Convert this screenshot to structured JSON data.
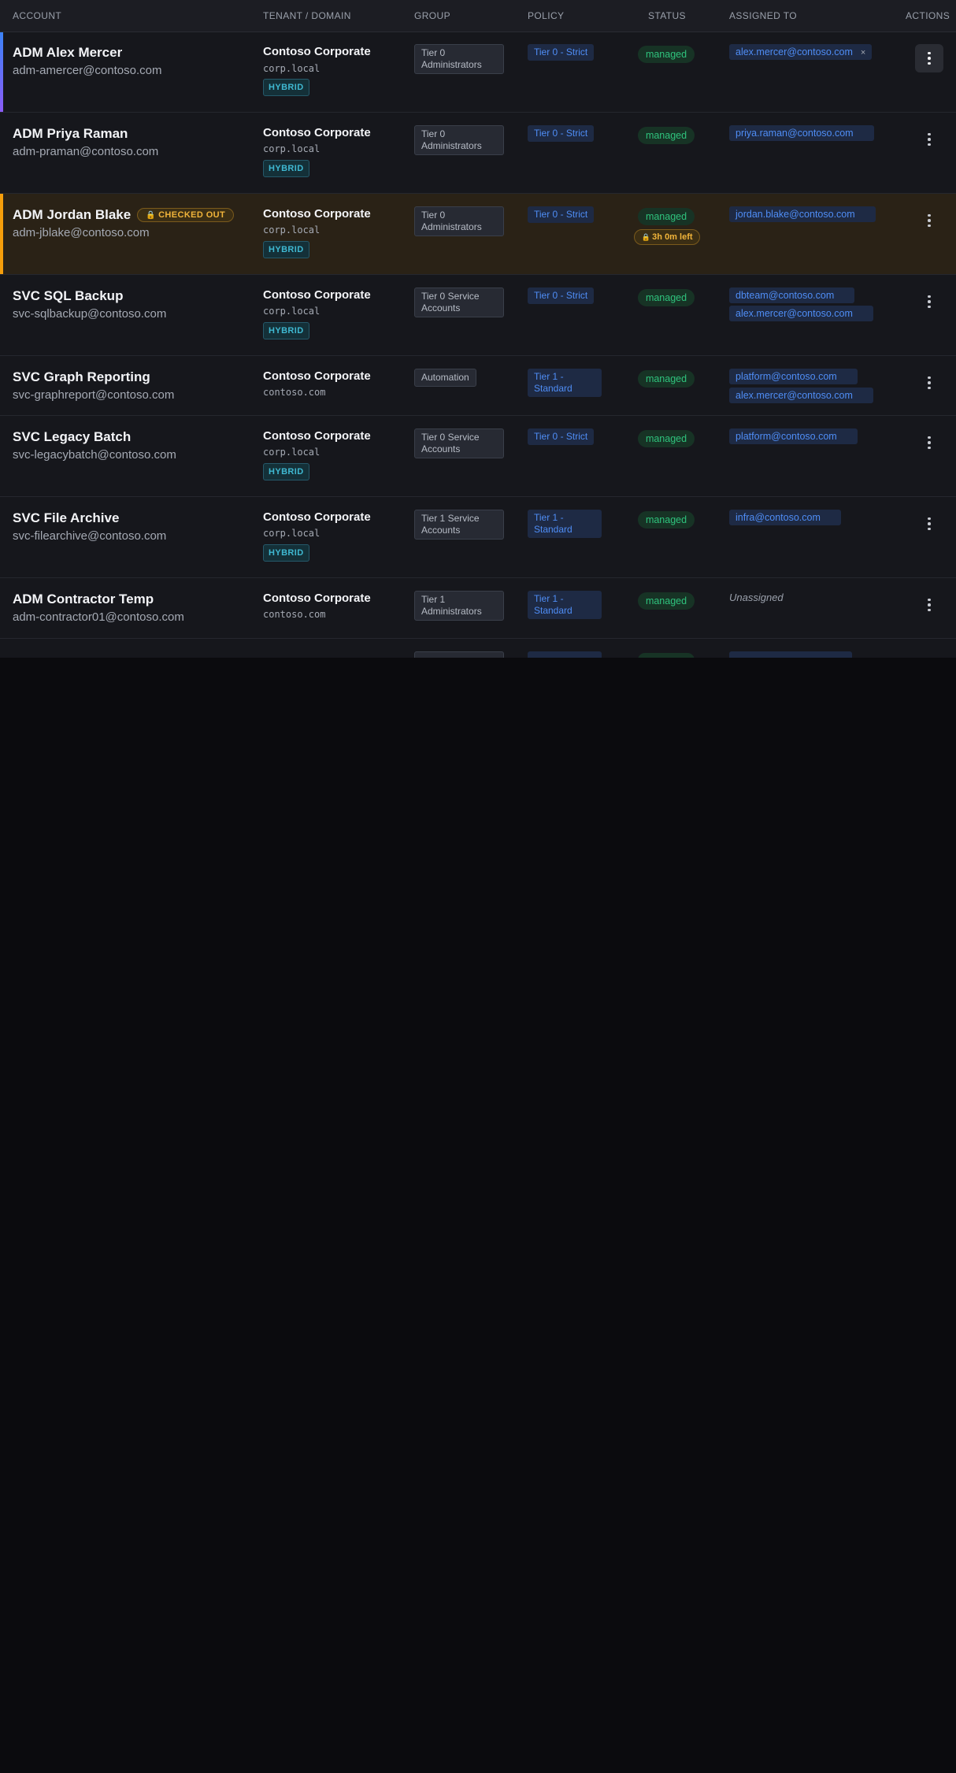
{
  "columns": {
    "account": "ACCOUNT",
    "tenant": "TENANT / DOMAIN",
    "group": "GROUP",
    "policy": "POLICY",
    "status": "STATUS",
    "assigned": "ASSIGNED TO",
    "actions": "ACTIONS"
  },
  "colors": {
    "accent_selected": "#4f6ef7",
    "accent_checked_out": "#f59e0b",
    "status_managed": "#2fc37d",
    "link": "#4f8df5",
    "hybrid": "#3fb8d1"
  },
  "rows": [
    {
      "name": "ADM Alex Mercer",
      "email": "adm-amercer@contoso.com",
      "tenant": "Contoso Corporate",
      "domain": "corp.local",
      "hybrid": "HYBRID",
      "group": "Tier 0 Administrators",
      "policy": "Tier 0 - Strict",
      "status": "managed",
      "assigned": [
        "alex.mercer@contoso.com"
      ],
      "remove_icon": "×"
    },
    {
      "name": "ADM Priya Raman",
      "email": "adm-praman@contoso.com",
      "tenant": "Contoso Corporate",
      "domain": "corp.local",
      "hybrid": "HYBRID",
      "group": "Tier 0 Administrators",
      "policy": "Tier 0 - Strict",
      "status": "managed",
      "assigned": [
        "priya.raman@contoso.com"
      ]
    },
    {
      "name": "ADM Jordan Blake",
      "badge": "CHECKED OUT",
      "email": "adm-jblake@contoso.com",
      "tenant": "Contoso Corporate",
      "domain": "corp.local",
      "hybrid": "HYBRID",
      "group": "Tier 0 Administrators",
      "policy": "Tier 0 - Strict",
      "status": "managed",
      "time_left": "3h 0m left",
      "assigned": [
        "jordan.blake@contoso.com"
      ]
    },
    {
      "name": "SVC SQL Backup",
      "email": "svc-sqlbackup@contoso.com",
      "tenant": "Contoso Corporate",
      "domain": "corp.local",
      "hybrid": "HYBRID",
      "group": "Tier 0 Service Accounts",
      "policy": "Tier 0 - Strict",
      "status": "managed",
      "assigned": [
        "dbteam@contoso.com",
        "alex.mercer@contoso.com"
      ]
    },
    {
      "name": "SVC Graph Reporting",
      "email": "svc-graphreport@contoso.com",
      "tenant": "Contoso Corporate",
      "domain": "contoso.com",
      "group": "Automation",
      "policy": "Tier 1 - Standard",
      "status": "managed",
      "assigned": [
        "platform@contoso.com",
        "alex.mercer@contoso.com"
      ]
    },
    {
      "name": "SVC Legacy Batch",
      "email": "svc-legacybatch@contoso.com",
      "tenant": "Contoso Corporate",
      "domain": "corp.local",
      "hybrid": "HYBRID",
      "group": "Tier 0 Service Accounts",
      "policy": "Tier 0 - Strict",
      "status": "managed",
      "assigned": [
        "platform@contoso.com"
      ]
    },
    {
      "name": "SVC File Archive",
      "email": "svc-filearchive@contoso.com",
      "tenant": "Contoso Corporate",
      "domain": "corp.local",
      "hybrid": "HYBRID",
      "group": "Tier 1 Service Accounts",
      "policy": "Tier 1 - Standard",
      "status": "managed",
      "assigned": [
        "infra@contoso.com"
      ]
    },
    {
      "name": "ADM Contractor Temp",
      "email": "adm-contractor01@contoso.com",
      "tenant": "Contoso Corporate",
      "domain": "contoso.com",
      "group": "Tier 1 Administrators",
      "policy": "Tier 1 - Standard",
      "status": "managed",
      "unassigned": "Unassigned"
    }
  ]
}
